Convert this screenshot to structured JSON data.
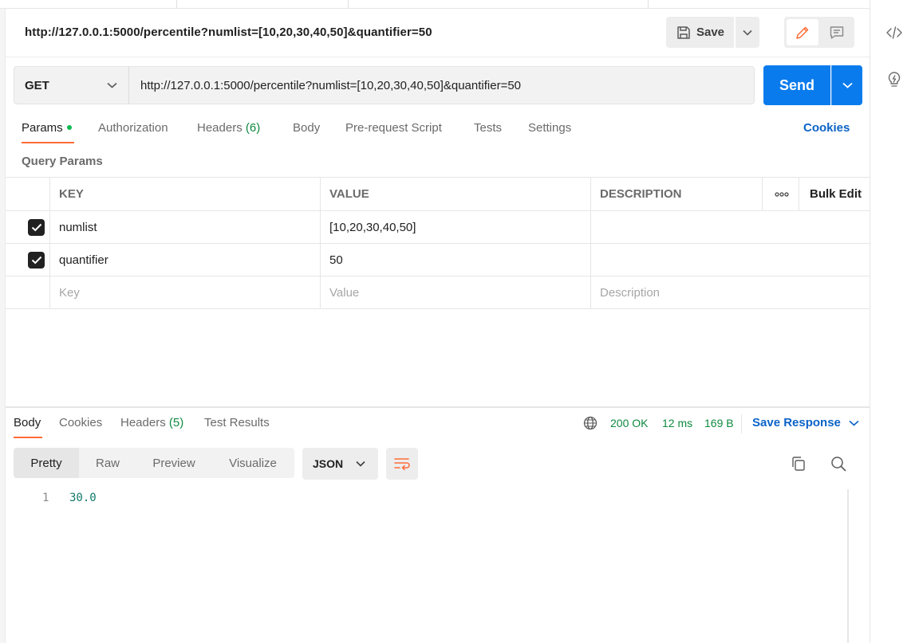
{
  "request": {
    "title": "http://127.0.0.1:5000/percentile?numlist=[10,20,30,40,50]&quantifier=50",
    "method": "GET",
    "url": "http://127.0.0.1:5000/percentile?numlist=[10,20,30,40,50]&quantifier=50",
    "save_label": "Save",
    "send_label": "Send"
  },
  "request_tabs": [
    {
      "label": "Params",
      "count": ""
    },
    {
      "label": "Authorization",
      "count": ""
    },
    {
      "label": "Headers ",
      "count": "(6)"
    },
    {
      "label": "Body",
      "count": ""
    },
    {
      "label": "Pre-request Script",
      "count": ""
    },
    {
      "label": "Tests",
      "count": ""
    },
    {
      "label": "Settings",
      "count": ""
    }
  ],
  "cookies_label": "Cookies",
  "query_params": {
    "label": "Query Params",
    "headers": {
      "key": "KEY",
      "value": "VALUE",
      "description": "DESCRIPTION",
      "bulk_edit": "Bulk Edit"
    },
    "rows": [
      {
        "key": "numlist",
        "value": "[10,20,30,40,50]",
        "description": "",
        "checked": true
      },
      {
        "key": "quantifier",
        "value": "50",
        "description": "",
        "checked": true
      }
    ],
    "placeholders": {
      "key": "Key",
      "value": "Value",
      "description": "Description"
    }
  },
  "response_tabs": [
    {
      "label": "Body",
      "count": ""
    },
    {
      "label": "Cookies",
      "count": ""
    },
    {
      "label": "Headers ",
      "count": "(5)"
    },
    {
      "label": "Test Results",
      "count": ""
    }
  ],
  "response_status": {
    "status": "200 OK",
    "time": "12 ms",
    "size": "169 B"
  },
  "save_response_label": "Save Response",
  "view_modes": [
    "Pretty",
    "Raw",
    "Preview",
    "Visualize"
  ],
  "format": "JSON",
  "response_body": {
    "line_number": "1",
    "value": "30.0"
  },
  "colors": {
    "accent": "#ff6c37",
    "send": "#097bed",
    "link": "#0b63c7",
    "status_green": "#0e8a3f"
  }
}
